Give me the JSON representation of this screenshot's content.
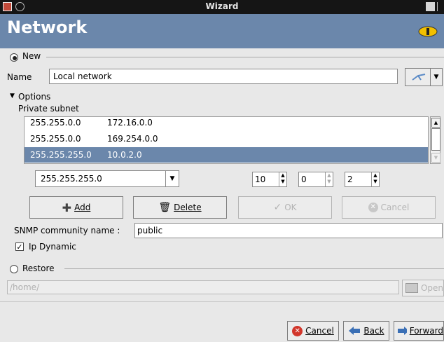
{
  "window": {
    "title": "Wizard"
  },
  "header": {
    "title": "Network"
  },
  "new_group": {
    "label": "New"
  },
  "name_row": {
    "label": "Name",
    "value": "Local network"
  },
  "options": {
    "label": "Options",
    "subnet_label": "Private subnet"
  },
  "subnets": {
    "rows": [
      {
        "mask": "255.255.0.0",
        "ip": "172.16.0.0"
      },
      {
        "mask": "255.255.0.0",
        "ip": "169.254.0.0"
      },
      {
        "mask": "255.255.255.0",
        "ip": "10.0.2.0"
      }
    ],
    "selected_index": 2
  },
  "editor": {
    "mask_value": "255.255.255.0",
    "octet1": "10",
    "octet2": "0",
    "octet3": "2"
  },
  "actions": {
    "add": "Add",
    "delete": "Delete",
    "ok": "OK",
    "cancel": "Cancel"
  },
  "snmp": {
    "label": "SNMP community name :",
    "value": "public"
  },
  "ip_dynamic": {
    "label": "Ip Dynamic",
    "checked": true
  },
  "restore": {
    "label": "Restore",
    "path_placeholder": "/home/",
    "open_label": "Open"
  },
  "footer": {
    "cancel": "Cancel",
    "back": "Back",
    "forward": "Forward"
  },
  "colors": {
    "header_bg": "#6b87ab",
    "selection_bg": "#6b87ab",
    "titlebar_bg": "#151515"
  }
}
